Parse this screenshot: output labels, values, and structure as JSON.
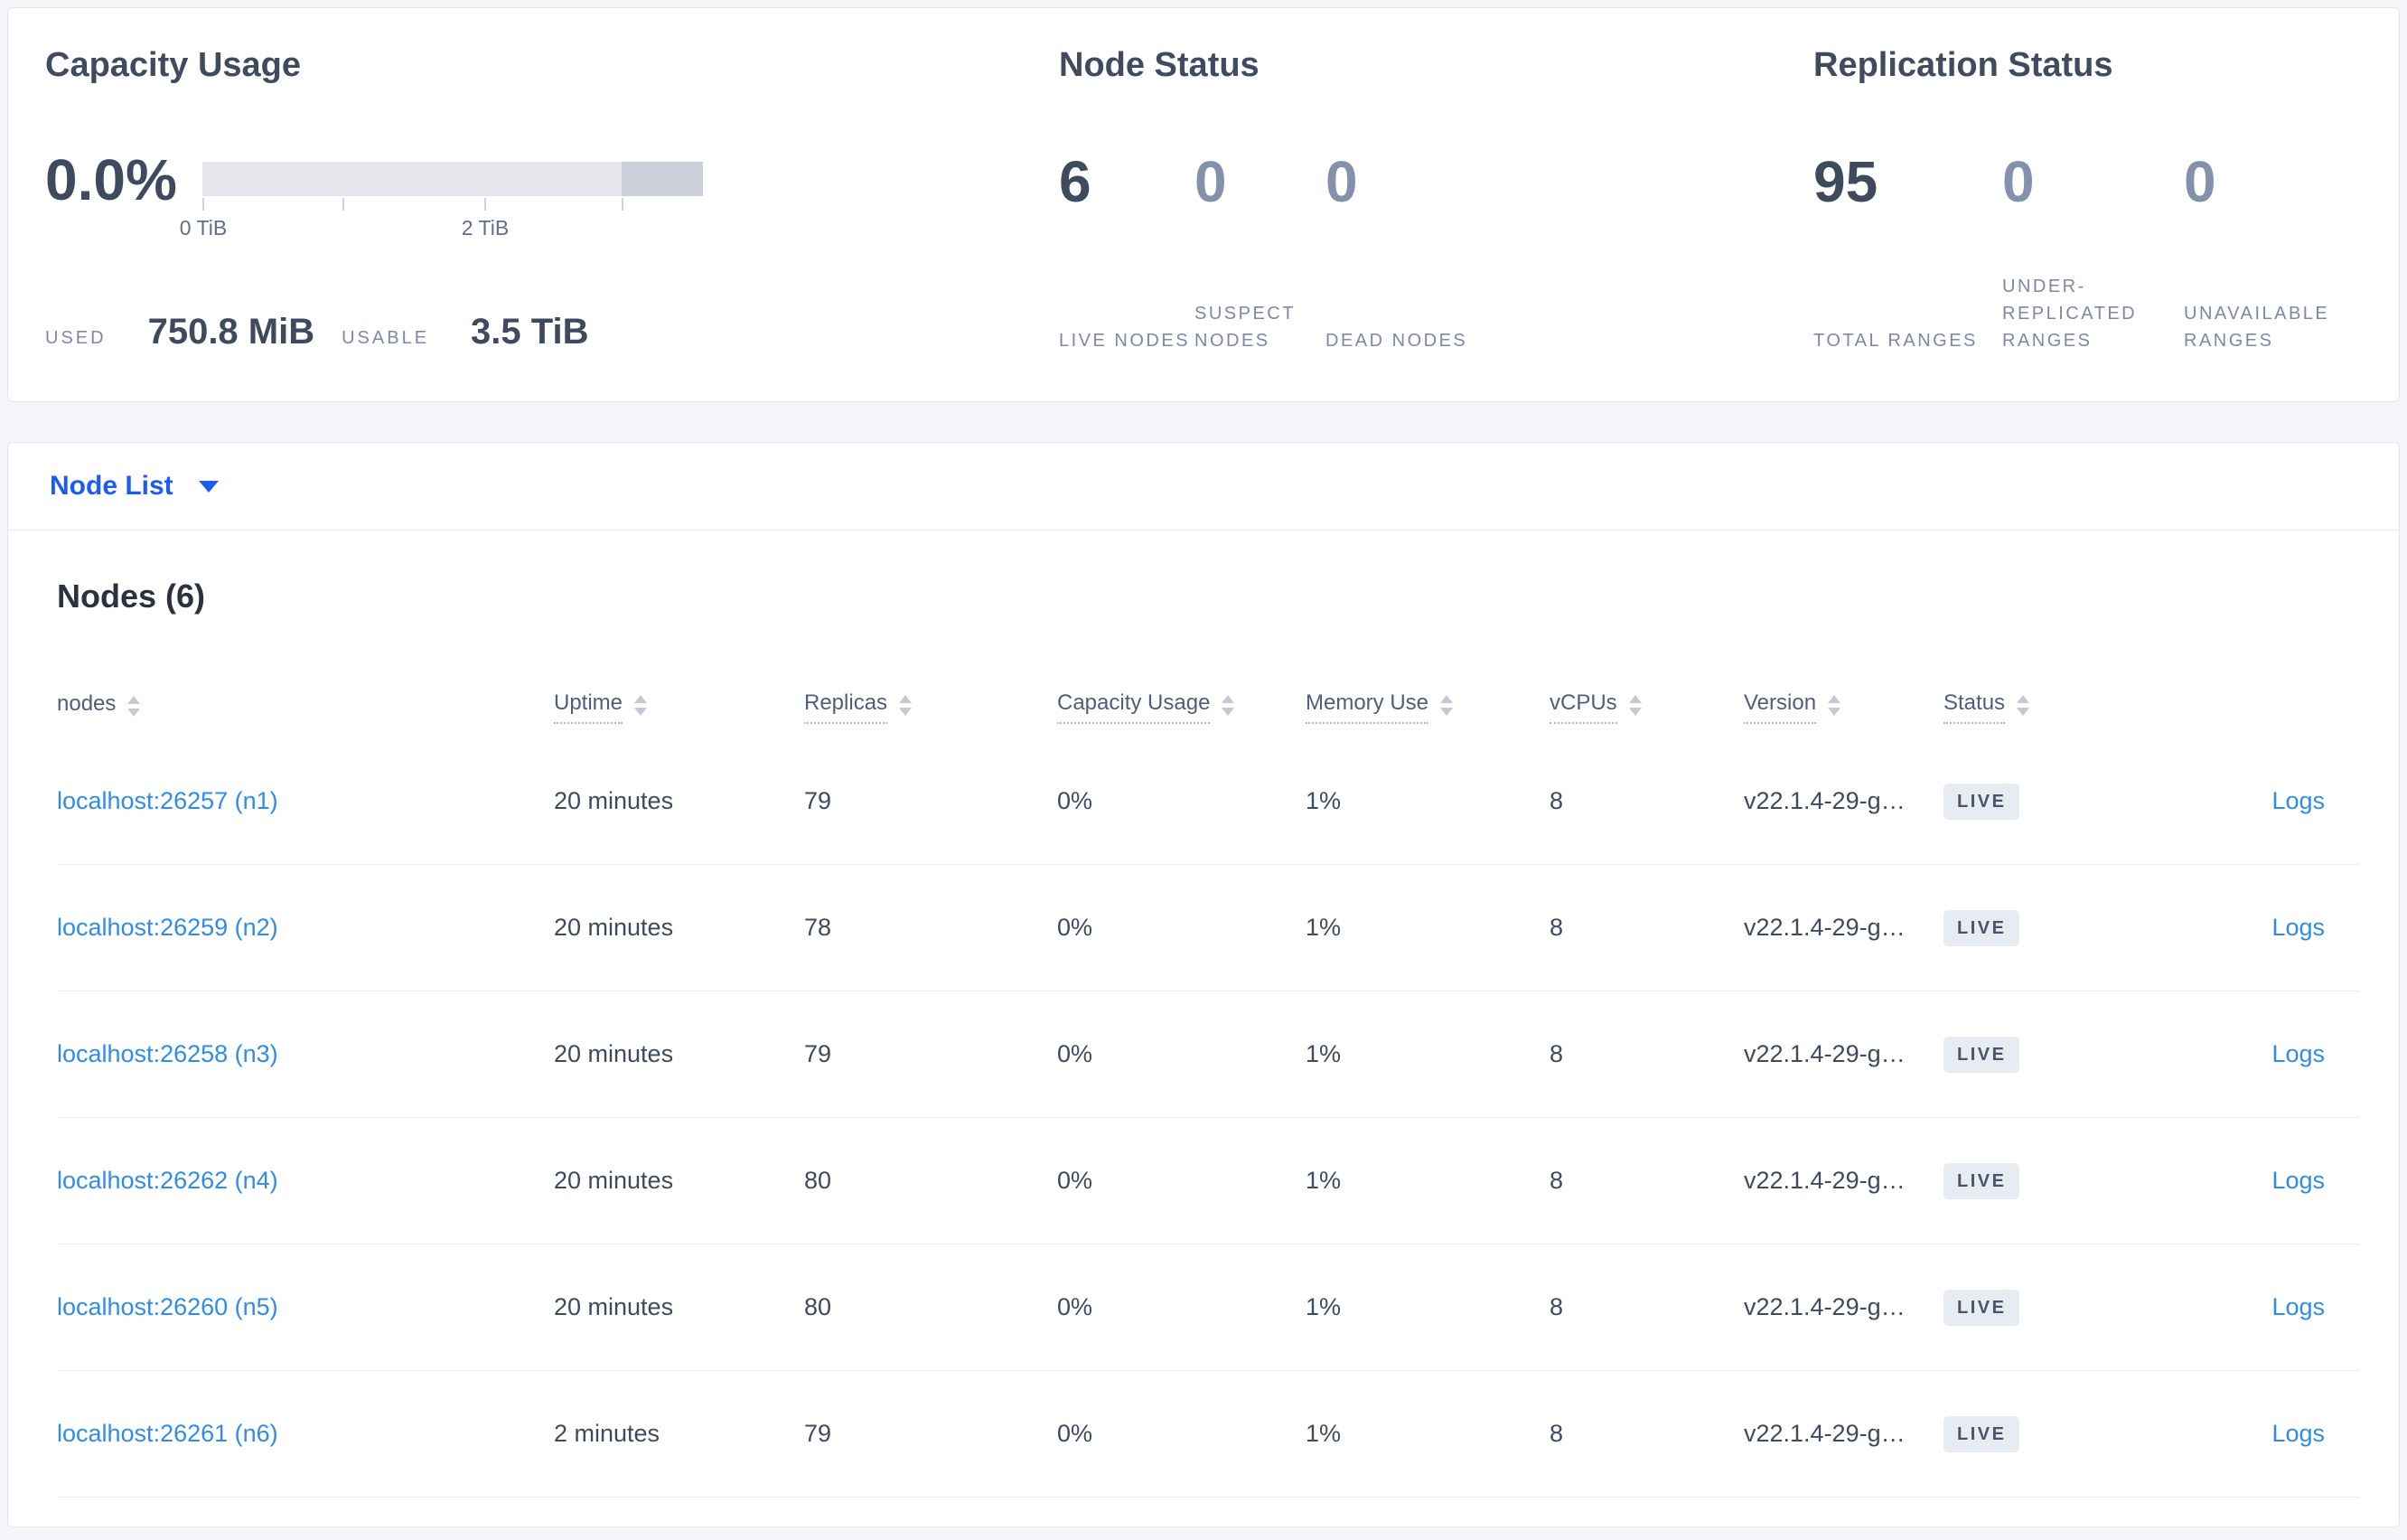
{
  "colors": {
    "accent_blue": "#1c5cf5",
    "link_blue": "#2f8bee",
    "text_dark": "#3e4a5e",
    "text_muted": "#7c88a5",
    "badge_bg": "#e7ebf2"
  },
  "capacity": {
    "title": "Capacity Usage",
    "percent": "0.0%",
    "axis_ticks": [
      "0 TiB",
      "2 TiB"
    ],
    "used_label": "USED",
    "used_value": "750.8 MiB",
    "usable_label": "USABLE",
    "usable_value": "3.5 TiB"
  },
  "node_status": {
    "title": "Node Status",
    "stats": [
      {
        "value": "6",
        "label": "LIVE NODES"
      },
      {
        "value": "0",
        "label": "SUSPECT NODES"
      },
      {
        "value": "0",
        "label": "DEAD NODES"
      }
    ]
  },
  "replication_status": {
    "title": "Replication Status",
    "stats": [
      {
        "value": "95",
        "label": "TOTAL RANGES"
      },
      {
        "value": "0",
        "label": "UNDER-REPLICATED RANGES"
      },
      {
        "value": "0",
        "label": "UNAVAILABLE RANGES"
      }
    ]
  },
  "node_list": {
    "label": "Node List"
  },
  "table": {
    "title": "Nodes (6)",
    "logs_label": "Logs",
    "columns": [
      {
        "label": "nodes"
      },
      {
        "label": "Uptime"
      },
      {
        "label": "Replicas"
      },
      {
        "label": "Capacity Usage"
      },
      {
        "label": "Memory Use"
      },
      {
        "label": "vCPUs"
      },
      {
        "label": "Version"
      },
      {
        "label": "Status"
      }
    ],
    "rows": [
      {
        "node": "localhost:26257 (n1)",
        "uptime": "20 minutes",
        "replicas": "79",
        "capacity_usage": "0%",
        "memory_use": "1%",
        "vcpus": "8",
        "version": "v22.1.4-29-g…",
        "status": "LIVE"
      },
      {
        "node": "localhost:26259 (n2)",
        "uptime": "20 minutes",
        "replicas": "78",
        "capacity_usage": "0%",
        "memory_use": "1%",
        "vcpus": "8",
        "version": "v22.1.4-29-g…",
        "status": "LIVE"
      },
      {
        "node": "localhost:26258 (n3)",
        "uptime": "20 minutes",
        "replicas": "79",
        "capacity_usage": "0%",
        "memory_use": "1%",
        "vcpus": "8",
        "version": "v22.1.4-29-g…",
        "status": "LIVE"
      },
      {
        "node": "localhost:26262 (n4)",
        "uptime": "20 minutes",
        "replicas": "80",
        "capacity_usage": "0%",
        "memory_use": "1%",
        "vcpus": "8",
        "version": "v22.1.4-29-g…",
        "status": "LIVE"
      },
      {
        "node": "localhost:26260 (n5)",
        "uptime": "20 minutes",
        "replicas": "80",
        "capacity_usage": "0%",
        "memory_use": "1%",
        "vcpus": "8",
        "version": "v22.1.4-29-g…",
        "status": "LIVE"
      },
      {
        "node": "localhost:26261 (n6)",
        "uptime": "2 minutes",
        "replicas": "79",
        "capacity_usage": "0%",
        "memory_use": "1%",
        "vcpus": "8",
        "version": "v22.1.4-29-g…",
        "status": "LIVE"
      }
    ]
  }
}
